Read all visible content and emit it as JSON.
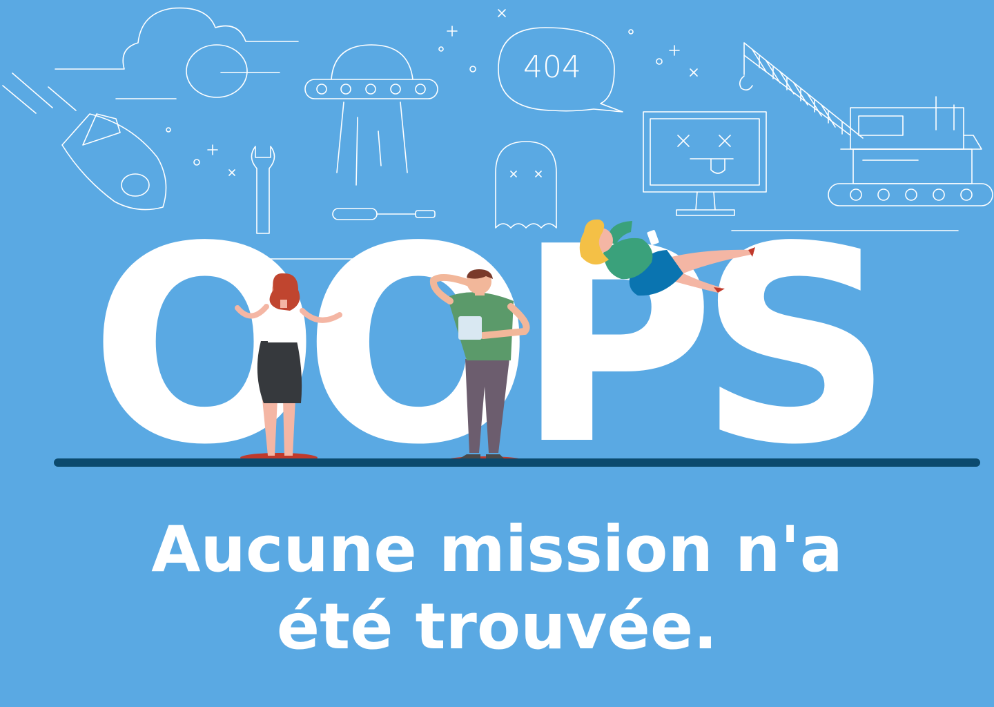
{
  "illustration": {
    "big_word": "OOPS",
    "speech_bubble_text": "404",
    "icons": [
      "cloud-icon",
      "planet-icon",
      "ufo-icon",
      "speech-bubble-icon",
      "rocket-icon",
      "wrench-icon",
      "screwdriver-icon",
      "ghost-icon",
      "broken-monitor-icon",
      "crane-icon"
    ],
    "colors": {
      "background": "#5aa9e3",
      "baseline": "#0b4a6e",
      "text": "#ffffff"
    }
  },
  "message": {
    "text": "Aucune mission n'a été trouvée."
  }
}
